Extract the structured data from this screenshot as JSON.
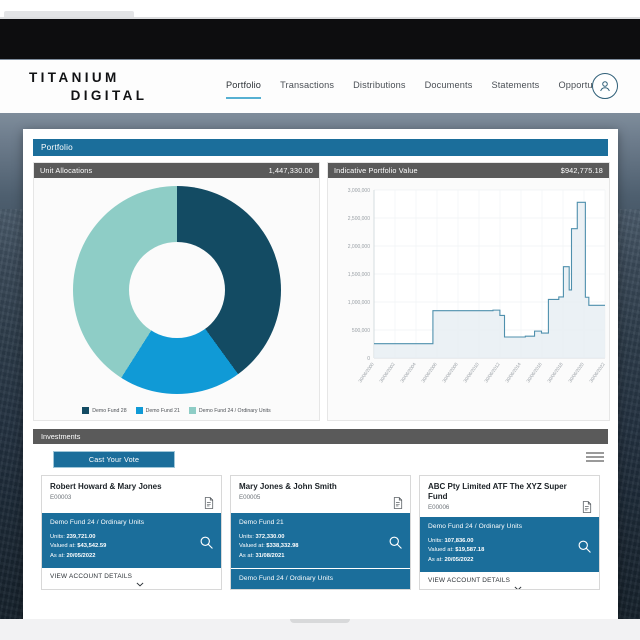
{
  "brand": {
    "line1": "TITANIUM",
    "line2": "DIGITAL"
  },
  "nav": {
    "items": [
      {
        "label": "Portfolio",
        "active": true
      },
      {
        "label": "Transactions",
        "active": false
      },
      {
        "label": "Distributions",
        "active": false
      },
      {
        "label": "Documents",
        "active": false
      },
      {
        "label": "Statements",
        "active": false
      },
      {
        "label": "Opportunities",
        "active": false
      }
    ],
    "avatar_icon": "user-avatar-icon"
  },
  "portfolio": {
    "header": "Portfolio",
    "unit_allocations": {
      "title": "Unit Allocations",
      "value": "1,447,330.00"
    },
    "indicative_value": {
      "title": "Indicative Portfolio Value",
      "value": "$942,775.18"
    }
  },
  "chart_data": [
    {
      "type": "pie",
      "title": "Unit Allocations",
      "total": "1,447,330.00",
      "legend_position": "bottom",
      "categories": [
        "Demo Fund 28",
        "Demo Fund 21",
        "Demo Fund 24 / Ordinary Units"
      ],
      "values": [
        40,
        19,
        41
      ],
      "colors": [
        "#134b63",
        "#109ad6",
        "#8ecdc6"
      ]
    },
    {
      "type": "area",
      "title": "Indicative Portfolio Value",
      "xlabel": "",
      "ylabel": "",
      "ylim": [
        0,
        3000000
      ],
      "ytick_labels": [
        "0",
        "500,000",
        "1,000,000",
        "1,500,000",
        "2,000,000",
        "2,500,000",
        "3,000,000"
      ],
      "yticks": [
        0,
        500000,
        1000000,
        1500000,
        2000000,
        2500000,
        3000000
      ],
      "grid": true,
      "line_color": "#4f90ad",
      "fill_color": "#e8eff3",
      "x": [
        "30/06/2000",
        "30/06/2002",
        "30/06/2004",
        "30/06/2006",
        "30/06/2008",
        "30/06/2010",
        "30/06/2012",
        "30/06/2014",
        "30/06/2016",
        "30/06/2018",
        "30/06/2020",
        "30/06/2022"
      ],
      "xtick_labels": [
        "30/06/2000",
        "30/06/2002",
        "30/06/2004",
        "30/06/2006",
        "30/06/2008",
        "30/06/2010",
        "30/06/2012",
        "30/06/2014",
        "30/06/2016",
        "30/06/2018",
        "30/06/2020",
        "30/06/2022"
      ],
      "step_points": [
        [
          0.0,
          255000
        ],
        [
          0.255,
          255000
        ],
        [
          0.255,
          845000
        ],
        [
          0.515,
          845000
        ],
        [
          0.515,
          855000
        ],
        [
          0.545,
          855000
        ],
        [
          0.545,
          760000
        ],
        [
          0.565,
          760000
        ],
        [
          0.565,
          375000
        ],
        [
          0.655,
          375000
        ],
        [
          0.655,
          390000
        ],
        [
          0.695,
          390000
        ],
        [
          0.695,
          480000
        ],
        [
          0.725,
          480000
        ],
        [
          0.725,
          445000
        ],
        [
          0.755,
          445000
        ],
        [
          0.755,
          1045000
        ],
        [
          0.8,
          1045000
        ],
        [
          0.8,
          1090000
        ],
        [
          0.82,
          1090000
        ],
        [
          0.82,
          1630000
        ],
        [
          0.845,
          1630000
        ],
        [
          0.845,
          1215000
        ],
        [
          0.855,
          1215000
        ],
        [
          0.855,
          2310000
        ],
        [
          0.88,
          2310000
        ],
        [
          0.88,
          2780000
        ],
        [
          0.915,
          2780000
        ],
        [
          0.915,
          1085000
        ],
        [
          0.93,
          1085000
        ],
        [
          0.93,
          940000
        ],
        [
          1.0,
          940000
        ]
      ]
    }
  ],
  "investments": {
    "header": "Investments",
    "vote_button": "Cast Your Vote",
    "list_icon": "list-view-icon",
    "view_details_label": "VIEW ACCOUNT DETAILS",
    "labels": {
      "units": "Units:",
      "valued": "Valued at:",
      "asat": "As at:"
    },
    "cards": [
      {
        "name": "Robert Howard & Mary Jones",
        "code": "E00003",
        "doc_icon": "document-icon",
        "search_icon": "search-icon",
        "funds": [
          {
            "title": "Demo Fund 24 / Ordinary Units",
            "units": "239,721.00",
            "valued_at": "$43,542.59",
            "as_at": "20/05/2022"
          }
        ],
        "has_footer": true
      },
      {
        "name": "Mary Jones & John Smith",
        "code": "E00005",
        "doc_icon": "document-icon",
        "search_icon": "search-icon",
        "funds": [
          {
            "title": "Demo Fund 21",
            "units": "372,330.00",
            "valued_at": "$338,332.98",
            "as_at": "31/08/2021"
          },
          {
            "title": "Demo Fund 24 / Ordinary Units",
            "units": "",
            "valued_at": "",
            "as_at": ""
          }
        ],
        "has_footer": false
      },
      {
        "name": "ABC Pty Limited ATF The XYZ Super Fund",
        "code": "E00006",
        "doc_icon": "document-icon",
        "search_icon": "search-icon",
        "funds": [
          {
            "title": "Demo Fund 24 / Ordinary Units",
            "units": "107,836.00",
            "valued_at": "$19,587.18",
            "as_at": "20/05/2022"
          }
        ],
        "has_footer": true
      }
    ]
  },
  "colors": {
    "brand_blue": "#1b6e9b",
    "accent_underline": "#56b0d2",
    "header_grey": "#5a5a5a",
    "donut_dark": "#134b63",
    "donut_blue": "#109ad6",
    "donut_teal": "#8ecdc6"
  }
}
